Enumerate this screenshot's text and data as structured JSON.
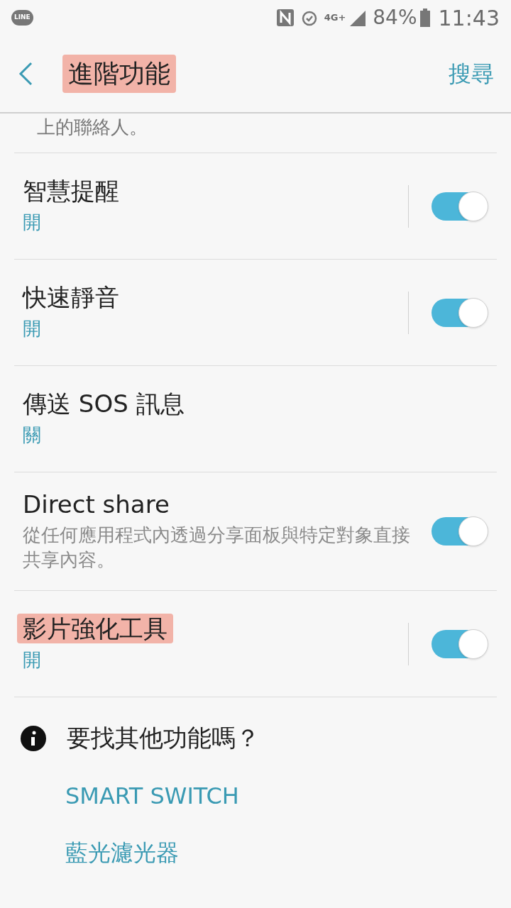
{
  "status_bar": {
    "app_icon_label": "LINE",
    "network": "4G+",
    "battery": "84%",
    "time": "11:43"
  },
  "header": {
    "title": "進階功能",
    "title_highlighted": true,
    "action": "搜尋"
  },
  "settings": [
    {
      "kind": "text",
      "description": "上的聯絡人。"
    },
    {
      "kind": "toggle",
      "title": "智慧提醒",
      "status": "開",
      "on": true,
      "split": true,
      "highlighted": false
    },
    {
      "kind": "toggle",
      "title": "快速靜音",
      "status": "開",
      "on": true,
      "split": true,
      "highlighted": false
    },
    {
      "kind": "plain",
      "title": "傳送 SOS 訊息",
      "status": "關",
      "highlighted": false
    },
    {
      "kind": "toggle",
      "title": "Direct share",
      "description": "從任何應用程式內透過分享面板與特定對象直接共享內容。",
      "on": true,
      "split": false,
      "highlighted": false
    },
    {
      "kind": "toggle",
      "title": "影片強化工具",
      "status": "開",
      "on": true,
      "split": true,
      "highlighted": true
    }
  ],
  "more": {
    "question": "要找其他功能嗎？",
    "links": [
      "SMART SWITCH",
      "藍光濾光器"
    ]
  }
}
